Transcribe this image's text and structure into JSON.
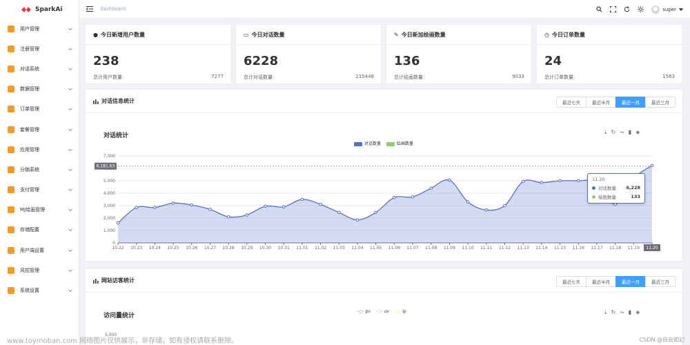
{
  "app": {
    "name": "SparkAi"
  },
  "breadcrumb": "dashboard",
  "user": {
    "name": "super"
  },
  "sidebar": {
    "items": [
      {
        "label": "用户管理",
        "color": "#f59a23"
      },
      {
        "label": "注册管理",
        "color": "#f59a23"
      },
      {
        "label": "对话系统",
        "color": "#f59a23"
      },
      {
        "label": "数据管理",
        "color": "#f59a23"
      },
      {
        "label": "订单管理",
        "color": "#f59a23"
      },
      {
        "label": "套餐管理",
        "color": "#f59a23"
      },
      {
        "label": "应用管理",
        "color": "#f59a23"
      },
      {
        "label": "分销系统",
        "color": "#f59a23"
      },
      {
        "label": "支付管理",
        "color": "#f59a23"
      },
      {
        "label": "MJ绘画管理",
        "color": "#f59a23"
      },
      {
        "label": "存储配置",
        "color": "#f59a23"
      },
      {
        "label": "用户端设置",
        "color": "#f59a23"
      },
      {
        "label": "风控管理",
        "color": "#f59a23"
      },
      {
        "label": "系统设置",
        "color": "#f59a23"
      }
    ]
  },
  "stats": [
    {
      "title": "今日新增用户数量",
      "value": "238",
      "sub_label": "总计用户数量:",
      "sub_value": "7277"
    },
    {
      "title": "今日对话数量",
      "value": "6228",
      "sub_label": "总计对话数量:",
      "sub_value": "215448"
    },
    {
      "title": "今日新加绘画数量",
      "value": "136",
      "sub_label": "总计绘画数量:",
      "sub_value": "9033"
    },
    {
      "title": "今日订单数量",
      "value": "24",
      "sub_label": "总计订单数量:",
      "sub_value": "1563"
    }
  ],
  "range_buttons": [
    "最近七天",
    "最近半月",
    "最近一月",
    "最近三月"
  ],
  "range_active": "最近一月",
  "panel1": {
    "title": "对话信息统计",
    "chart_title": "对话统计"
  },
  "panel2": {
    "title": "网站访客统计",
    "chart_title": "访问量统计",
    "y_top": "5,000"
  },
  "tooltip": {
    "date": "11.20",
    "rows": [
      {
        "label": "对话数量",
        "value": "6,228",
        "color": "#5470c6"
      },
      {
        "label": "绘画数量",
        "value": "133",
        "color": "#91cc75"
      }
    ]
  },
  "axis_pointer": {
    "y_label": "6,181.63",
    "x_label": "11.20"
  },
  "chart_data": {
    "type": "area",
    "title": "对话统计",
    "legend": [
      "对话数量",
      "绘画数量"
    ],
    "ylim": [
      0,
      7000
    ],
    "yticks": [
      0,
      1000,
      2000,
      3000,
      4000,
      5000,
      6000,
      7000
    ],
    "yticklabels": [
      "0",
      "1,000",
      "2,000",
      "3,000",
      "4,000",
      "5,000",
      "6,000",
      "7,000"
    ],
    "categories": [
      "10.22",
      "10.23",
      "10.24",
      "10.25",
      "10.26",
      "10.27",
      "10.28",
      "10.29",
      "10.30",
      "10.31",
      "11.01",
      "11.02",
      "11.03",
      "11.04",
      "11.05",
      "11.06",
      "11.07",
      "11.08",
      "11.09",
      "11.10",
      "11.11",
      "11.12",
      "11.13",
      "11.14",
      "11.15",
      "11.16",
      "11.17",
      "11.18",
      "11.19",
      "11.20"
    ],
    "series": [
      {
        "name": "对话数量",
        "color": "#5470c6",
        "values": [
          1600,
          2850,
          2850,
          3200,
          3050,
          2700,
          2100,
          2250,
          2950,
          2900,
          3500,
          3100,
          2450,
          1850,
          2450,
          3650,
          3700,
          4400,
          5050,
          3300,
          2650,
          3000,
          4950,
          4850,
          5000,
          5000,
          4900,
          3100,
          5200,
          6228
        ]
      }
    ]
  },
  "panel2_legend": [
    {
      "label": "pv",
      "color": "#5470c6"
    },
    {
      "label": "uv",
      "color": "#91cc75"
    },
    {
      "label": "ip",
      "color": "#fac858"
    }
  ],
  "watermark": "www.toymoban.com 网络图片仅供展示，非存储，如有侵权请联系删除。",
  "watermark_right": "CSDN @白云如幻"
}
